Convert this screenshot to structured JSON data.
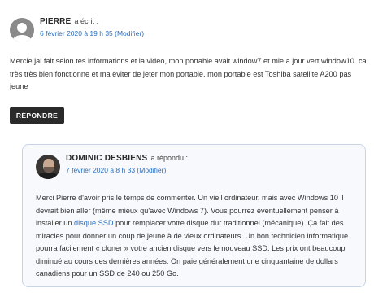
{
  "comment": {
    "author": "PIERRE",
    "says": "a écrit :",
    "date": "6 février 2020 à 19 h 35 (Modifier)",
    "text": "Mercie jai fait selon tes informations et la video, mon portable avait window7 et mie a jour vert window10. ca très très bien fonctionne et ma éviter de jeter mon portable. mon portable est Toshiba satellite A200 pas jeune",
    "reply_label": "RÉPONDRE"
  },
  "reply": {
    "author": "DOMINIC DESBIENS",
    "says": "a répondu :",
    "date": "7 février 2020 à 8 h 33 (Modifier)",
    "text_before_link": "Merci Pierre d'avoir pris le temps de commenter. Un vieil ordinateur, mais avec Windows 10 il devrait bien aller (même mieux qu'avec Windows 7). Vous pourrez éventuellement penser à installer un ",
    "link_text": "disque SSD",
    "text_after_link": " pour remplacer votre disque dur traditionnel (mécanique). Ça fait des miracles pour donner un coup de jeune à de vieux ordinateurs. Un bon technicien informatique pourra facilement « cloner » votre ancien disque vers le nouveau SSD. Les prix ont beaucoup diminué au cours des dernières années. On paie généralement une cinquantaine de dollars canadiens pour un SSD de 240 ou 250 Go."
  },
  "colors": {
    "link": "#2a6fbf",
    "button_bg": "#2a2a2a",
    "reply_border": "#c6d4e6"
  }
}
